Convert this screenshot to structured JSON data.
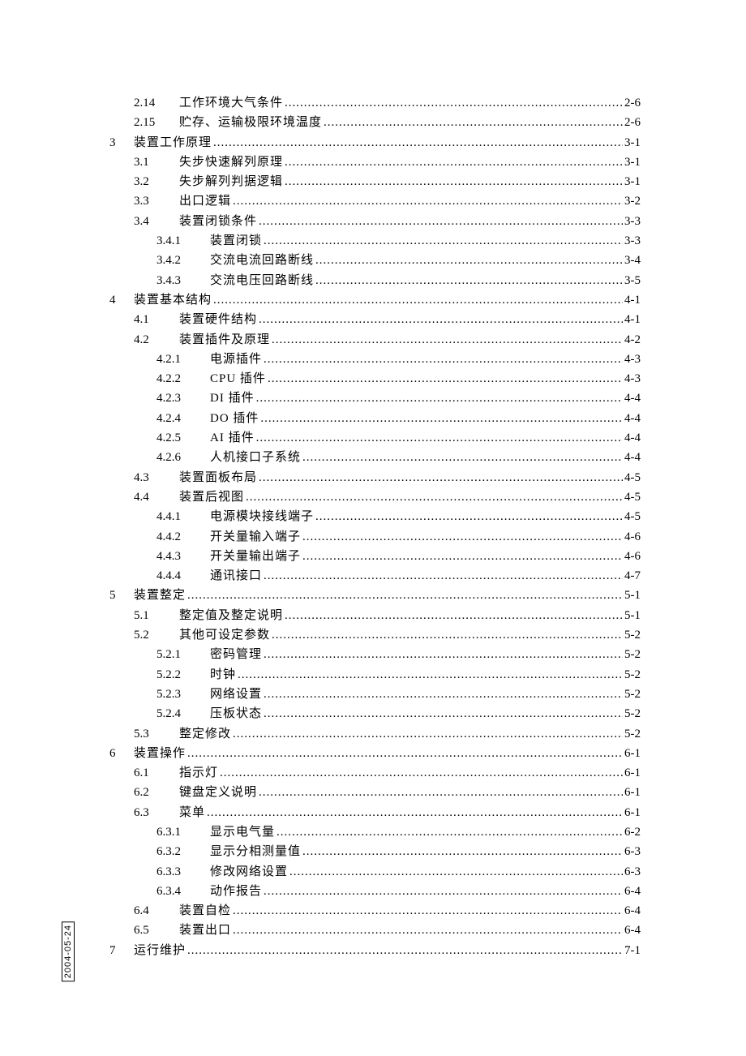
{
  "sideDate": "2004-05-24",
  "entries": [
    {
      "level": 2,
      "num": "2.14",
      "title": "工作环境大气条件",
      "page": "2-6"
    },
    {
      "level": 2,
      "num": "2.15",
      "title": "贮存、运输极限环境温度",
      "page": "2-6"
    },
    {
      "level": 1,
      "num": "3",
      "title": "装置工作原理",
      "page": "3-1"
    },
    {
      "level": 2,
      "num": "3.1",
      "title": "失步快速解列原理",
      "page": "3-1"
    },
    {
      "level": 2,
      "num": "3.2",
      "title": "失步解列判据逻辑",
      "page": "3-1"
    },
    {
      "level": 2,
      "num": "3.3",
      "title": "出口逻辑",
      "page": "3-2"
    },
    {
      "level": 2,
      "num": "3.4",
      "title": "装置闭锁条件",
      "page": "3-3"
    },
    {
      "level": 3,
      "num": "3.4.1",
      "title": "装置闭锁",
      "page": "3-3"
    },
    {
      "level": 3,
      "num": "3.4.2",
      "title": "交流电流回路断线",
      "page": "3-4"
    },
    {
      "level": 3,
      "num": "3.4.3",
      "title": "交流电压回路断线",
      "page": "3-5"
    },
    {
      "level": 1,
      "num": "4",
      "title": "装置基本结构",
      "page": "4-1"
    },
    {
      "level": 2,
      "num": "4.1",
      "title": "装置硬件结构",
      "page": "4-1"
    },
    {
      "level": 2,
      "num": "4.2",
      "title": "装置插件及原理",
      "page": "4-2"
    },
    {
      "level": 3,
      "num": "4.2.1",
      "title": "电源插件",
      "page": "4-3"
    },
    {
      "level": 3,
      "num": "4.2.2",
      "title": "CPU 插件",
      "page": "4-3"
    },
    {
      "level": 3,
      "num": "4.2.3",
      "title": "DI 插件",
      "page": "4-4"
    },
    {
      "level": 3,
      "num": "4.2.4",
      "title": "DO 插件",
      "page": "4-4"
    },
    {
      "level": 3,
      "num": "4.2.5",
      "title": "AI 插件",
      "page": "4-4"
    },
    {
      "level": 3,
      "num": "4.2.6",
      "title": "人机接口子系统",
      "page": "4-4"
    },
    {
      "level": 2,
      "num": "4.3",
      "title": "装置面板布局",
      "page": "4-5"
    },
    {
      "level": 2,
      "num": "4.4",
      "title": "装置后视图",
      "page": "4-5"
    },
    {
      "level": 3,
      "num": "4.4.1",
      "title": "电源模块接线端子",
      "page": "4-5"
    },
    {
      "level": 3,
      "num": "4.4.2",
      "title": "开关量输入端子",
      "page": "4-6"
    },
    {
      "level": 3,
      "num": "4.4.3",
      "title": "开关量输出端子",
      "page": "4-6"
    },
    {
      "level": 3,
      "num": "4.4.4",
      "title": "通讯接口",
      "page": "4-7"
    },
    {
      "level": 1,
      "num": "5",
      "title": "装置整定",
      "page": "5-1"
    },
    {
      "level": 2,
      "num": "5.1",
      "title": "整定值及整定说明",
      "page": "5-1"
    },
    {
      "level": 2,
      "num": "5.2",
      "title": "其他可设定参数",
      "page": "5-2"
    },
    {
      "level": 3,
      "num": "5.2.1",
      "title": "密码管理",
      "page": "5-2"
    },
    {
      "level": 3,
      "num": "5.2.2",
      "title": "时钟",
      "page": "5-2"
    },
    {
      "level": 3,
      "num": "5.2.3",
      "title": "网络设置",
      "page": "5-2"
    },
    {
      "level": 3,
      "num": "5.2.4",
      "title": "压板状态",
      "page": "5-2"
    },
    {
      "level": 2,
      "num": "5.3",
      "title": "整定修改",
      "page": "5-2"
    },
    {
      "level": 1,
      "num": "6",
      "title": "装置操作",
      "page": "6-1"
    },
    {
      "level": 2,
      "num": "6.1",
      "title": "指示灯",
      "page": "6-1"
    },
    {
      "level": 2,
      "num": "6.2",
      "title": "键盘定义说明",
      "page": "6-1"
    },
    {
      "level": 2,
      "num": "6.3",
      "title": "菜单",
      "page": "6-1"
    },
    {
      "level": 3,
      "num": "6.3.1",
      "title": "显示电气量",
      "page": "6-2"
    },
    {
      "level": 3,
      "num": "6.3.2",
      "title": "显示分相测量值",
      "page": "6-3"
    },
    {
      "level": 3,
      "num": "6.3.3",
      "title": "修改网络设置",
      "page": "6-3"
    },
    {
      "level": 3,
      "num": "6.3.4",
      "title": "动作报告",
      "page": "6-4"
    },
    {
      "level": 2,
      "num": "6.4",
      "title": "装置自检",
      "page": "6-4"
    },
    {
      "level": 2,
      "num": "6.5",
      "title": "装置出口",
      "page": "6-4"
    },
    {
      "level": 1,
      "num": "7",
      "title": "运行维护",
      "page": "7-1"
    }
  ]
}
